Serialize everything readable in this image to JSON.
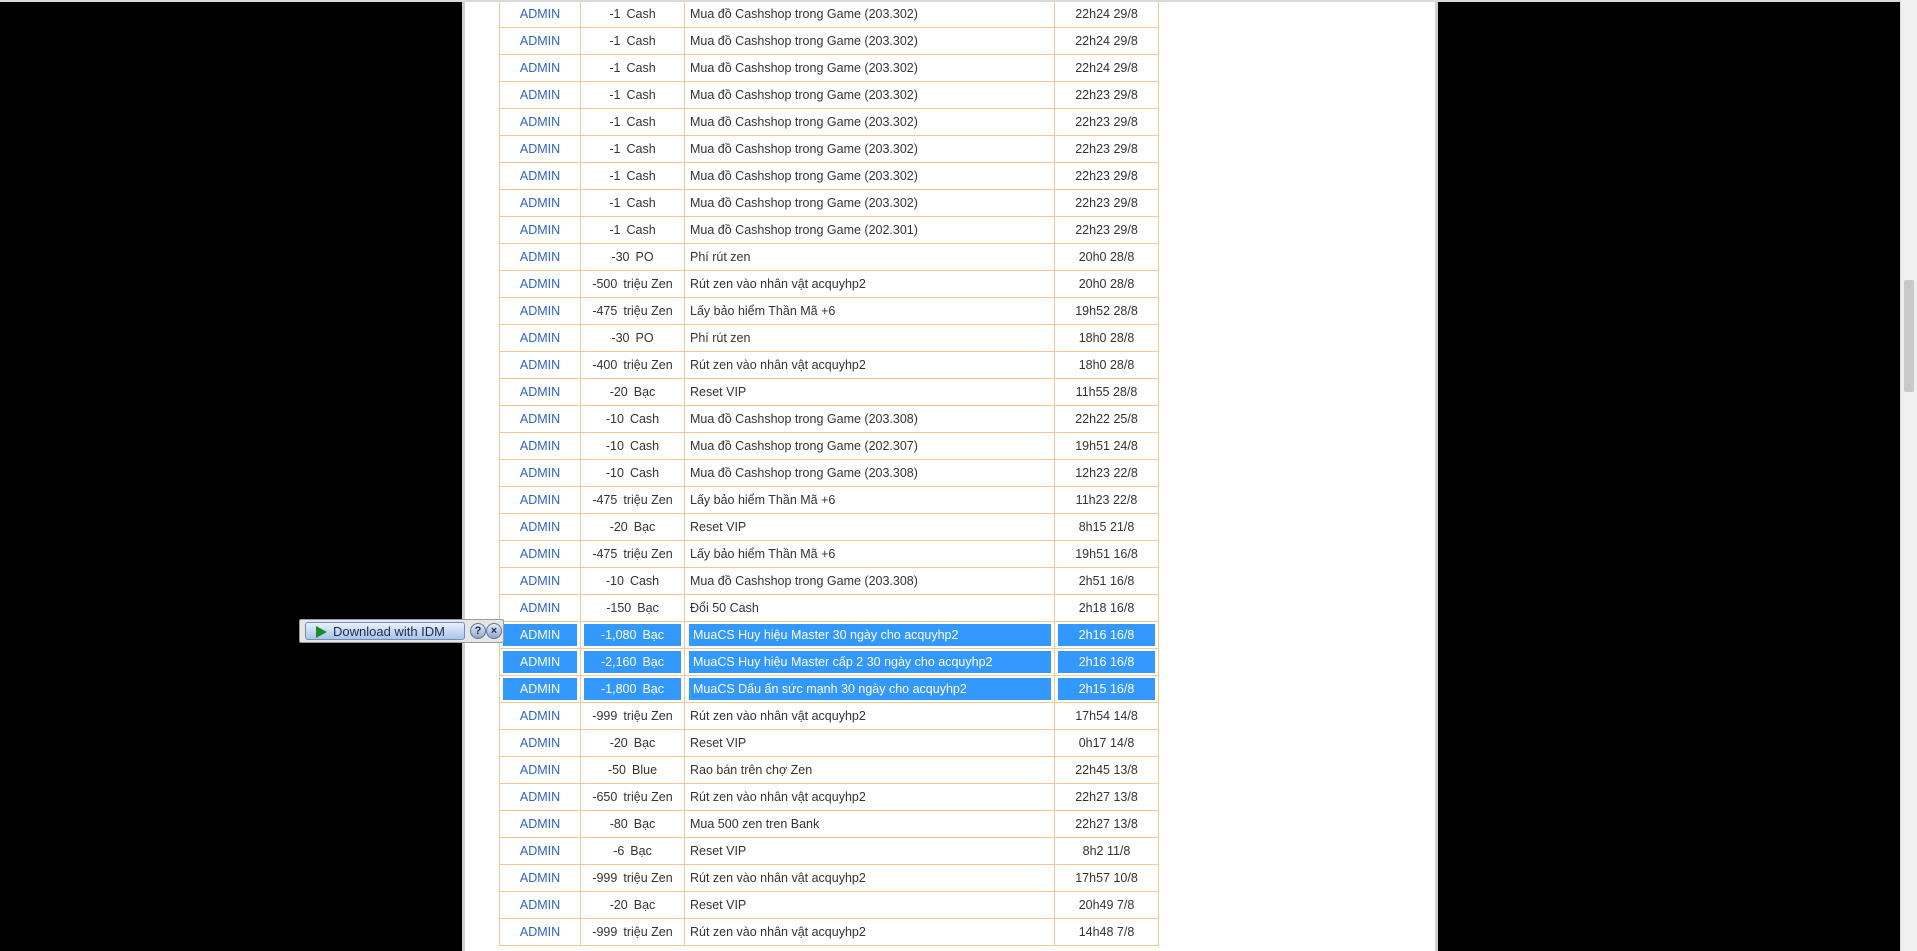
{
  "idm": {
    "label": "Download with IDM",
    "help": "?",
    "close": "×"
  },
  "rows": [
    {
      "user": "ADMIN",
      "amount": "-1",
      "unit": "Cash",
      "desc": "Mua đồ Cashshop trong Game (203.302)",
      "time": "22h24 29/8"
    },
    {
      "user": "ADMIN",
      "amount": "-1",
      "unit": "Cash",
      "desc": "Mua đồ Cashshop trong Game (203.302)",
      "time": "22h24 29/8"
    },
    {
      "user": "ADMIN",
      "amount": "-1",
      "unit": "Cash",
      "desc": "Mua đồ Cashshop trong Game (203.302)",
      "time": "22h24 29/8"
    },
    {
      "user": "ADMIN",
      "amount": "-1",
      "unit": "Cash",
      "desc": "Mua đồ Cashshop trong Game (203.302)",
      "time": "22h23 29/8"
    },
    {
      "user": "ADMIN",
      "amount": "-1",
      "unit": "Cash",
      "desc": "Mua đồ Cashshop trong Game (203.302)",
      "time": "22h23 29/8"
    },
    {
      "user": "ADMIN",
      "amount": "-1",
      "unit": "Cash",
      "desc": "Mua đồ Cashshop trong Game (203.302)",
      "time": "22h23 29/8"
    },
    {
      "user": "ADMIN",
      "amount": "-1",
      "unit": "Cash",
      "desc": "Mua đồ Cashshop trong Game (203.302)",
      "time": "22h23 29/8"
    },
    {
      "user": "ADMIN",
      "amount": "-1",
      "unit": "Cash",
      "desc": "Mua đồ Cashshop trong Game (203.302)",
      "time": "22h23 29/8"
    },
    {
      "user": "ADMIN",
      "amount": "-1",
      "unit": "Cash",
      "desc": "Mua đồ Cashshop trong Game (202.301)",
      "time": "22h23 29/8"
    },
    {
      "user": "ADMIN",
      "amount": "-30",
      "unit": "PO",
      "desc": "Phí rút zen",
      "time": "20h0 28/8"
    },
    {
      "user": "ADMIN",
      "amount": "-500",
      "unit": "triệu Zen",
      "desc": "Rút zen vào nhân vật acquyhp2",
      "time": "20h0 28/8"
    },
    {
      "user": "ADMIN",
      "amount": "-475",
      "unit": "triệu Zen",
      "desc": "Lấy bảo hiểm Thần Mã +6",
      "time": "19h52 28/8"
    },
    {
      "user": "ADMIN",
      "amount": "-30",
      "unit": "PO",
      "desc": "Phí rút zen",
      "time": "18h0 28/8"
    },
    {
      "user": "ADMIN",
      "amount": "-400",
      "unit": "triệu Zen",
      "desc": "Rút zen vào nhân vật acquyhp2",
      "time": "18h0 28/8"
    },
    {
      "user": "ADMIN",
      "amount": "-20",
      "unit": "Bạc",
      "desc": "Reset VIP",
      "time": "11h55 28/8"
    },
    {
      "user": "ADMIN",
      "amount": "-10",
      "unit": "Cash",
      "desc": "Mua đồ Cashshop trong Game (203.308)",
      "time": "22h22 25/8"
    },
    {
      "user": "ADMIN",
      "amount": "-10",
      "unit": "Cash",
      "desc": "Mua đồ Cashshop trong Game (202.307)",
      "time": "19h51 24/8"
    },
    {
      "user": "ADMIN",
      "amount": "-10",
      "unit": "Cash",
      "desc": "Mua đồ Cashshop trong Game (203.308)",
      "time": "12h23 22/8"
    },
    {
      "user": "ADMIN",
      "amount": "-475",
      "unit": "triệu Zen",
      "desc": "Lấy bảo hiểm Thần Mã +6",
      "time": "11h23 22/8"
    },
    {
      "user": "ADMIN",
      "amount": "-20",
      "unit": "Bạc",
      "desc": "Reset VIP",
      "time": "8h15 21/8"
    },
    {
      "user": "ADMIN",
      "amount": "-475",
      "unit": "triệu Zen",
      "desc": "Lấy bảo hiểm Thần Mã +6",
      "time": "19h51 16/8"
    },
    {
      "user": "ADMIN",
      "amount": "-10",
      "unit": "Cash",
      "desc": "Mua đồ Cashshop trong Game (203.308)",
      "time": "2h51 16/8"
    },
    {
      "user": "ADMIN",
      "amount": "-150",
      "unit": "Bạc",
      "desc": "Đổi 50 Cash",
      "time": "2h18 16/8"
    },
    {
      "user": "ADMIN",
      "amount": "-1,080",
      "unit": "Bạc",
      "desc": "MuaCS Huy hiệu Master 30 ngày cho acquyhp2",
      "time": "2h16 16/8",
      "selected": true
    },
    {
      "user": "ADMIN",
      "amount": "-2,160",
      "unit": "Bạc",
      "desc": "MuaCS Huy hiệu Master cấp 2 30 ngày cho acquyhp2",
      "time": "2h16 16/8",
      "selected": true
    },
    {
      "user": "ADMIN",
      "amount": "-1,800",
      "unit": "Bạc",
      "desc": "MuaCS Dấu ấn sức mạnh 30 ngày cho acquyhp2",
      "time": "2h15 16/8",
      "selected": true
    },
    {
      "user": "ADMIN",
      "amount": "-999",
      "unit": "triệu Zen",
      "desc": "Rút zen vào nhân vật acquyhp2",
      "time": "17h54 14/8"
    },
    {
      "user": "ADMIN",
      "amount": "-20",
      "unit": "Bạc",
      "desc": "Reset VIP",
      "time": "0h17 14/8"
    },
    {
      "user": "ADMIN",
      "amount": "-50",
      "unit": "Blue",
      "desc": "Rao bán trên chợ Zen",
      "time": "22h45 13/8"
    },
    {
      "user": "ADMIN",
      "amount": "-650",
      "unit": "triệu Zen",
      "desc": "Rút zen vào nhân vật acquyhp2",
      "time": "22h27 13/8"
    },
    {
      "user": "ADMIN",
      "amount": "-80",
      "unit": "Bạc",
      "desc": "Mua 500 zen tren Bank",
      "time": "22h27 13/8"
    },
    {
      "user": "ADMIN",
      "amount": "-6",
      "unit": "Bạc",
      "desc": "Reset VIP",
      "time": "8h2 11/8"
    },
    {
      "user": "ADMIN",
      "amount": "-999",
      "unit": "triệu Zen",
      "desc": "Rút zen vào nhân vật acquyhp2",
      "time": "17h57 10/8"
    },
    {
      "user": "ADMIN",
      "amount": "-20",
      "unit": "Bạc",
      "desc": "Reset VIP",
      "time": "20h49 7/8"
    },
    {
      "user": "ADMIN",
      "amount": "-999",
      "unit": "triệu Zen",
      "desc": "Rút zen vào nhân vật acquyhp2",
      "time": "14h48 7/8"
    }
  ]
}
